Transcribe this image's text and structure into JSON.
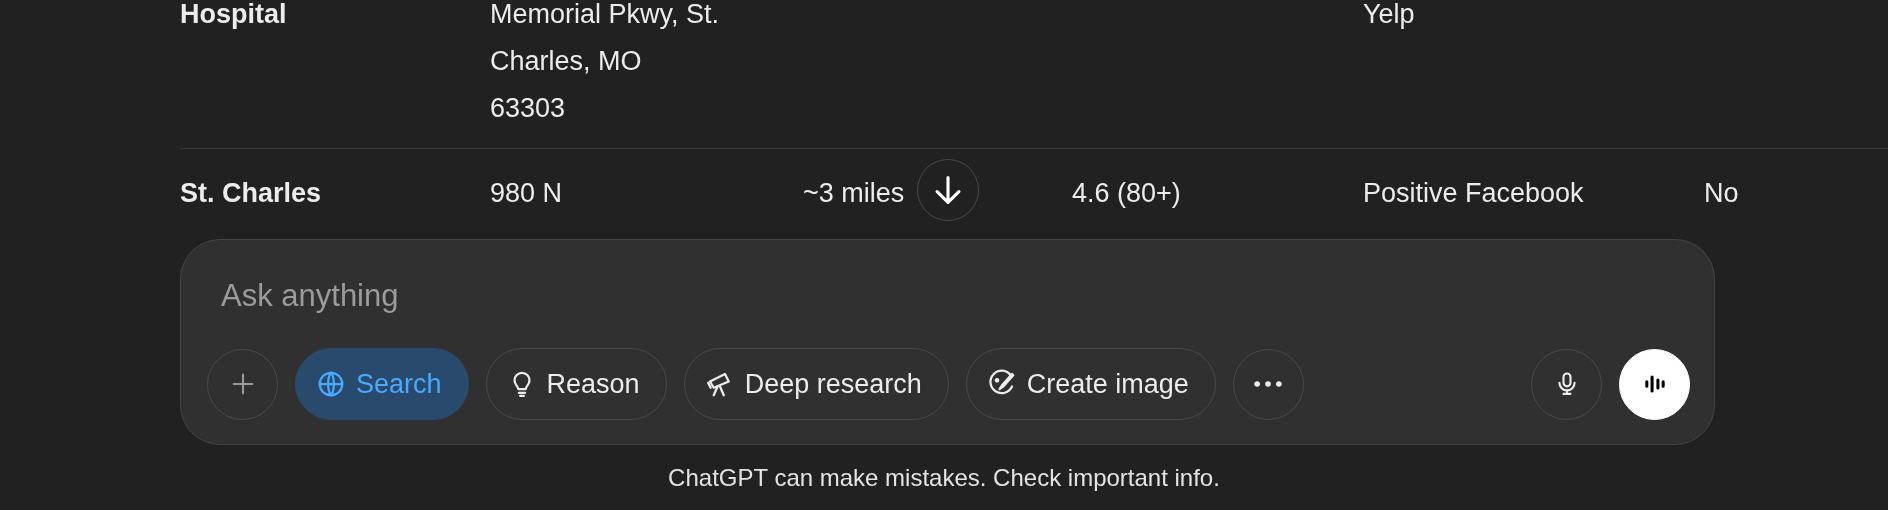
{
  "table": {
    "rows": [
      {
        "column_1": "Hospital",
        "column_2": "Memorial Pkwy, St.\nCharles, MO\n63303",
        "column_5": "Yelp"
      },
      {
        "column_1": "St. Charles",
        "column_2": "980 N",
        "column_3": "~3 miles",
        "column_4": "4.6 (80+)",
        "column_5": "Positive Facebook",
        "column_6": "No"
      }
    ]
  },
  "composer": {
    "placeholder": "Ask anything",
    "tools": [
      {
        "kind": "search",
        "label": "Search",
        "selected": true
      },
      {
        "kind": "reason",
        "label": "Reason",
        "selected": false
      },
      {
        "kind": "deep_research",
        "label": "Deep research",
        "selected": false
      },
      {
        "kind": "create_image",
        "label": "Create image",
        "selected": false
      }
    ]
  },
  "disclaimer": "ChatGPT can make mistakes. Check important info."
}
